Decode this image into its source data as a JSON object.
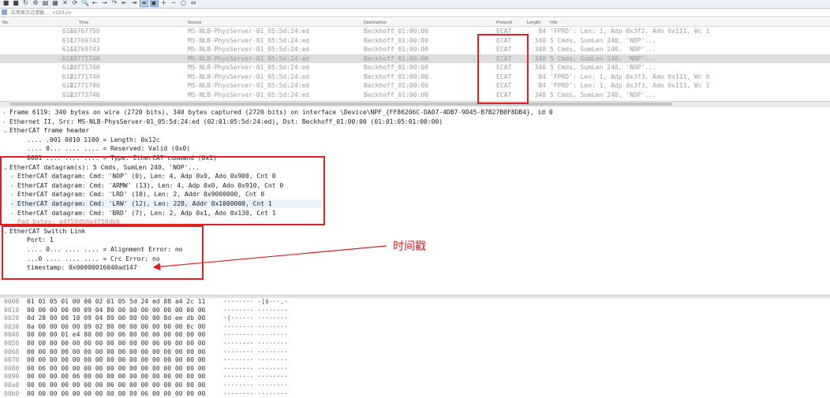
{
  "toolbar": {
    "icons": [
      "start-capture-icon",
      "stop-capture-icon",
      "restart-icon",
      "options-icon",
      "open-file-icon",
      "save-file-icon",
      "close-file-icon",
      "reload-icon",
      "find-packet-icon",
      "go-back-icon",
      "go-forward-icon",
      "go-to-packet-icon",
      "first-packet-icon",
      "last-packet-icon",
      "autoscroll-icon",
      "colorize-icon",
      "zoom-in-icon",
      "zoom-out-icon",
      "normal-size-icon",
      "resize-columns-icon"
    ]
  },
  "filter": {
    "placeholder": "应用显示过滤器 … <Ctrl-/>"
  },
  "packet_list": {
    "columns": [
      "No.",
      "Time",
      "Source",
      "Destination",
      "Protocol",
      "Length",
      "Info"
    ],
    "rows": [
      {
        "no": "6116",
        "time": "4.767750",
        "src": "MS-NLB-PhysServer-01_05:5d:24:ed",
        "dst": "Beckhoff_01:00:00",
        "proto": "ECAT",
        "len": "84",
        "info": "'FPRD': Len: 1, Adp 0x3f2, Ado 0x111, Wc 1"
      },
      {
        "no": "6117",
        "time": "4.769743",
        "src": "MS-NLB-PhysServer-01_05:5d:24:ed",
        "dst": "Beckhoff_01:00:00",
        "proto": "ECAT",
        "len": "340",
        "info": "5 Cmds, SumLen 240, 'NOP'..."
      },
      {
        "no": "6118",
        "time": "4.769743",
        "src": "MS-NLB-PhysServer-01_05:5d:24:ed",
        "dst": "Beckhoff_01:00:00",
        "proto": "ECAT",
        "len": "340",
        "info": "5 Cmds, SumLen 240, 'NOP'..."
      },
      {
        "no": "6119",
        "time": "4.771740",
        "src": "MS-NLB-PhysServer-01_05:5d:24:ed",
        "dst": "Beckhoff_01:00:00",
        "proto": "ECAT",
        "len": "340",
        "info": "5 Cmds, SumLen 240, 'NOP'..."
      },
      {
        "no": "6120",
        "time": "4.771740",
        "src": "MS-NLB-PhysServer-01_05:5d:24:ed",
        "dst": "Beckhoff_01:00:00",
        "proto": "ECAT",
        "len": "340",
        "info": "5 Cmds, SumLen 240, 'NOP'..."
      },
      {
        "no": "6121",
        "time": "4.771740",
        "src": "MS-NLB-PhysServer-01_05:5d:24:ed",
        "dst": "Beckhoff_01:00:00",
        "proto": "ECAT",
        "len": "84",
        "info": "'FPRD': Len: 1, Adp 0x3f3, Ado 0x111, Wc 0"
      },
      {
        "no": "6122",
        "time": "4.771740",
        "src": "MS-NLB-PhysServer-01_05:5d:24:ed",
        "dst": "Beckhoff_01:00:00",
        "proto": "ECAT",
        "len": "84",
        "info": "'FPRD': Len: 1, Adp 0x3f3, Ado 0x111, Wc 1"
      },
      {
        "no": "6123",
        "time": "4.773746",
        "src": "MS-NLB-PhysServer-01_05:5d:24:ed",
        "dst": "Beckhoff_01:00:00",
        "proto": "ECAT",
        "len": "340",
        "info": "5 Cmds, SumLen 240, 'NOP'..."
      }
    ],
    "selected_no": "6119"
  },
  "details": {
    "lines": [
      {
        "tw": "›",
        "text": "Frame 6119: 340 bytes on wire (2720 bits), 340 bytes captured (2720 bits) on interface \\Device\\NPF_{FF86206C-DA07-4DB7-9D45-B7B27B0F8DB4}, id 0"
      },
      {
        "tw": "›",
        "text": "Ethernet II, Src: MS-NLB-PhysServer-01_05:5d:24:ed (02:01:05:5d:24:ed), Dst: Beckhoff_01:00:00 (01:01:05:01:00:00)"
      },
      {
        "tw": "⌄",
        "text": "EtherCAT frame header"
      },
      {
        "tw": "",
        "text": ".... .001 0010 1100 = Length: 0x12c"
      },
      {
        "tw": "",
        "text": ".... 0... .... .... = Reserved: Valid (0x0)"
      },
      {
        "tw": "",
        "text": "0001 .... .... .... = Type: EtherCAT command (0x1)"
      },
      {
        "tw": "⌄",
        "text": "EtherCAT datagram(s): 5 Cmds, SumLen 240, 'NOP'..."
      },
      {
        "tw": "›",
        "text": "EtherCAT datagram: Cmd: 'NOP' (0), Len: 4, Adp 0x0, Ado 0x900, Cnt 0"
      },
      {
        "tw": "›",
        "text": "EtherCAT datagram: Cmd: 'ARMW' (13), Len: 4, Adp 0x0, Ado 0x910, Cnt 0"
      },
      {
        "tw": "›",
        "text": "EtherCAT datagram: Cmd: 'LRD' (10), Len: 2, Addr 0x9000000, Cnt 0"
      },
      {
        "tw": "›",
        "text": "EtherCAT datagram: Cmd: 'LRW' (12), Len: 228, Addr 0x1000000, Cnt 1"
      },
      {
        "tw": "›",
        "text": "EtherCAT datagram: Cmd: 'BRD' (7), Len: 2, Adp 0x1, Ado 0x130, Cnt 1"
      },
      {
        "tw": "",
        "text": "Pad bytes: e4f50db6e4f50db6"
      },
      {
        "tw": "⌄",
        "text": "EtherCAT Switch Link"
      },
      {
        "tw": "",
        "text": "Port: 1"
      },
      {
        "tw": "",
        "text": ".... 0... .... .... = Alignment Error: no"
      },
      {
        "tw": "",
        "text": "...0 .... .... .... = Crc Error: no"
      },
      {
        "tw": "",
        "text": "timestamp: 0x00000016040ad147"
      }
    ]
  },
  "hex": {
    "rows": [
      {
        "off": "0000",
        "bytes": "01 01 05 01 00 00 02 01  05 5d 24 ed 88 a4 2c 11",
        "ascii": "········ ·]$···,·"
      },
      {
        "off": "0010",
        "bytes": "00 00 00 00 00 09 04 80  00 00 00 00 00 00 00 00",
        "ascii": "········ ········"
      },
      {
        "off": "0020",
        "bytes": "0d 28 00 00 10 09 04 80  00 00 00 00 8d ee db 00",
        "ascii": "·(······ ········"
      },
      {
        "off": "0030",
        "bytes": "0a 00 00 00 00 09 02 80  00 00 00 00 00 00 0c 00",
        "ascii": "········ ········"
      },
      {
        "off": "0040",
        "bytes": "00 00 00 01 e4 80 00 00  06 00 00 00 00 00 00 00",
        "ascii": "········ ········"
      },
      {
        "off": "0050",
        "bytes": "00 00 00 00 00 00 00 00  00 00 00 06 00 00 00 00",
        "ascii": "········ ········"
      },
      {
        "off": "0060",
        "bytes": "00 00 00 00 00 00 00 00  00 00 00 00 00 00 00 00",
        "ascii": "········ ········"
      },
      {
        "off": "0070",
        "bytes": "00 00 00 00 00 00 00 00  00 00 00 00 00 00 00 00",
        "ascii": "········ ········"
      },
      {
        "off": "0080",
        "bytes": "00 06 00 00 00 00 00 00  00 00 00 00 00 00 00 00",
        "ascii": "········ ········"
      },
      {
        "off": "0090",
        "bytes": "00 00 00 00 06 00 00 00  00 00 00 00 00 00 00 00",
        "ascii": "········ ········"
      },
      {
        "off": "00a0",
        "bytes": "00 00 00 00 00 00 00 06  00 00 00 00 00 00 00 00",
        "ascii": "········ ········"
      },
      {
        "off": "00b0",
        "bytes": "00 00 00 00 00 00 00 00  00 00 06 00 00 00 00 00",
        "ascii": "········ ········"
      }
    ]
  },
  "annotation": {
    "label": "时间戳",
    "color": "#e02020"
  }
}
